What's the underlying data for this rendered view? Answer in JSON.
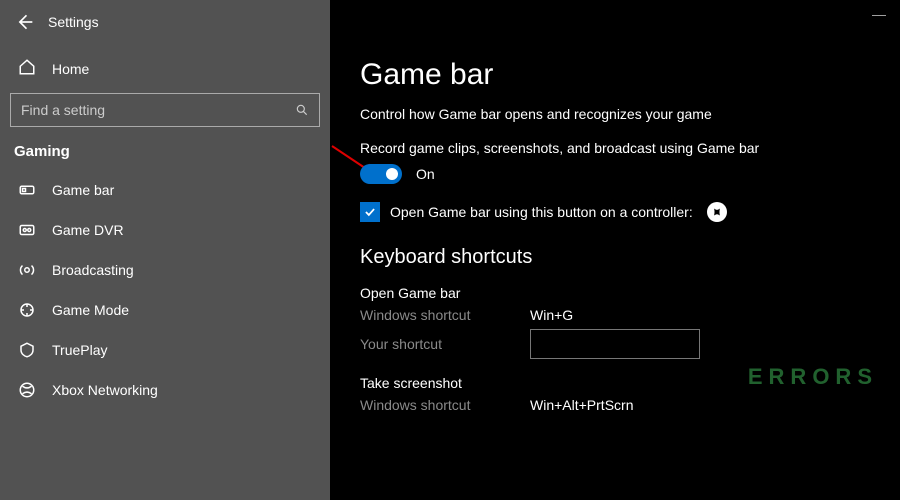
{
  "header": {
    "title": "Settings",
    "home_label": "Home",
    "search_placeholder": "Find a setting",
    "section_label": "Gaming"
  },
  "sidebar": {
    "items": [
      {
        "label": "Game bar",
        "icon": "game-bar-icon"
      },
      {
        "label": "Game DVR",
        "icon": "dvr-icon"
      },
      {
        "label": "Broadcasting",
        "icon": "broadcasting-icon"
      },
      {
        "label": "Game Mode",
        "icon": "game-mode-icon"
      },
      {
        "label": "TruePlay",
        "icon": "trueplay-icon"
      },
      {
        "label": "Xbox Networking",
        "icon": "xbox-networking-icon"
      }
    ]
  },
  "main": {
    "title": "Game bar",
    "subtitle": "Control how Game bar opens and recognizes your game",
    "record_label": "Record game clips, screenshots, and broadcast using Game bar",
    "toggle_state": "On",
    "checkbox_label": "Open Game bar using this button on a controller:",
    "keyboard_section_title": "Keyboard shortcuts",
    "shortcuts": [
      {
        "title": "Open Game bar",
        "windows_label": "Windows shortcut",
        "windows_value": "Win+G",
        "your_label": "Your shortcut",
        "your_value": ""
      },
      {
        "title": "Take screenshot",
        "windows_label": "Windows shortcut",
        "windows_value": "Win+Alt+PrtScrn"
      }
    ]
  },
  "watermark": "ERRORS",
  "colors": {
    "accent": "#0070cc",
    "sidebar": "#525252"
  }
}
